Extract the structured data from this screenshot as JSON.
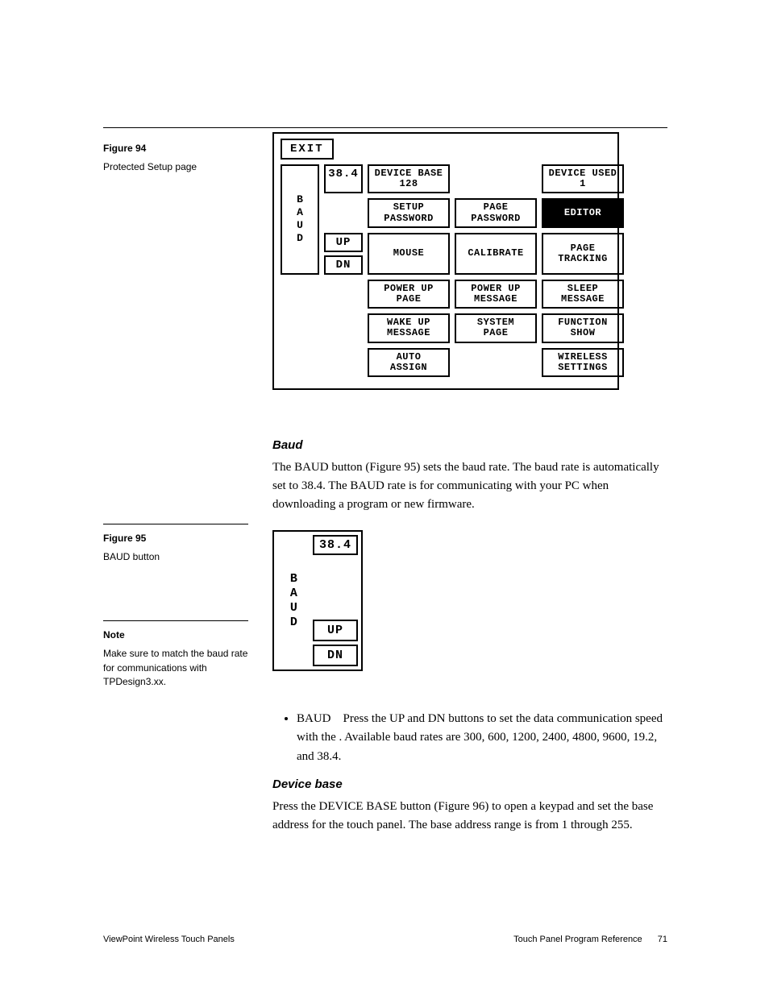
{
  "fig94_sidebar": {
    "title": "Figure 94",
    "caption": "Protected Setup page"
  },
  "panel94": {
    "exit": "EXIT",
    "rate": "38.4",
    "baud_label": "BAUD",
    "up": "UP",
    "dn": "DN",
    "device_base": {
      "l1": "DEVICE BASE",
      "l2": "128"
    },
    "device_used": {
      "l1": "DEVICE USED",
      "l2": "1"
    },
    "setup_password": {
      "l1": "SETUP",
      "l2": "PASSWORD"
    },
    "page_password": {
      "l1": "PAGE",
      "l2": "PASSWORD"
    },
    "editor": "EDITOR",
    "mouse": "MOUSE",
    "calibrate": "CALIBRATE",
    "page_tracking": {
      "l1": "PAGE",
      "l2": "TRACKING"
    },
    "power_up_page": {
      "l1": "POWER UP",
      "l2": "PAGE"
    },
    "power_up_message": {
      "l1": "POWER UP",
      "l2": "MESSAGE"
    },
    "sleep_message": {
      "l1": "SLEEP",
      "l2": "MESSAGE"
    },
    "wake_up_message": {
      "l1": "WAKE UP",
      "l2": "MESSAGE"
    },
    "system_page": {
      "l1": "SYSTEM",
      "l2": "PAGE"
    },
    "function_show": {
      "l1": "FUNCTION",
      "l2": "SHOW"
    },
    "auto_assign": {
      "l1": "AUTO",
      "l2": "ASSIGN"
    },
    "wireless_settings": {
      "l1": "WIRELESS",
      "l2": "SETTINGS"
    }
  },
  "section_baud": {
    "heading": "Baud",
    "para": "The BAUD button (Figure 95) sets the baud rate. The baud rate is automatically set to 38.4. The BAUD rate is for communicating with your PC when downloading a program or new firmware."
  },
  "fig95_sidebar": {
    "title": "Figure 95",
    "caption": "BAUD button"
  },
  "note_sidebar": {
    "title": "Note",
    "body": "Make sure to match the baud rate for communications with TPDesign3.xx."
  },
  "panel95": {
    "baud_label": "BAUD",
    "rate": "38.4",
    "up": "UP",
    "dn": "DN"
  },
  "bullet_baud": {
    "term": "BAUD",
    "text": "Press the UP and DN buttons to set the data communication speed with the . Available baud rates are 300, 600, 1200, 2400, 4800, 9600, 19.2, and 38.4."
  },
  "section_device_base": {
    "heading": "Device base",
    "para": "Press the DEVICE BASE button (Figure 96) to open a keypad and set the base address for the touch panel. The base address range is from 1 through 255."
  },
  "footer": {
    "left": "ViewPoint Wireless Touch Panels",
    "right": "Touch Panel Program Reference",
    "page": "71"
  }
}
